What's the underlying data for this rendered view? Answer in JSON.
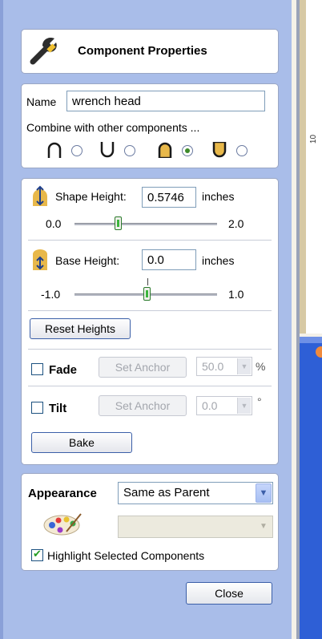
{
  "header": {
    "title": "Component Properties",
    "icon": "wrench-icon"
  },
  "name_section": {
    "name_label": "Name",
    "name_value": "wrench head",
    "combine_label": "Combine with other components ...",
    "combine_modes": [
      {
        "icon": "add-mode-icon",
        "selected": false
      },
      {
        "icon": "subtract-mode-icon",
        "selected": false
      },
      {
        "icon": "merge-high-mode-icon",
        "selected": true
      },
      {
        "icon": "merge-low-mode-icon",
        "selected": false
      }
    ]
  },
  "shape_height": {
    "label": "Shape Height:",
    "value": "0.5746",
    "unit": "inches",
    "min": "0.0",
    "max": "2.0",
    "slider_value": 0.5746
  },
  "base_height": {
    "label": "Base Height:",
    "value": "0.0",
    "unit": "inches",
    "min": "-1.0",
    "max": "1.0",
    "slider_value": 0.0
  },
  "reset_button": "Reset Heights",
  "fade": {
    "label": "Fade",
    "checked": false,
    "anchor_button": "Set Anchor",
    "value": "50.0",
    "unit": "%"
  },
  "tilt": {
    "label": "Tilt",
    "checked": false,
    "anchor_button": "Set Anchor",
    "value": "0.0",
    "unit": "°"
  },
  "bake_button": "Bake",
  "appearance": {
    "label": "Appearance",
    "selected": "Same as Parent",
    "palette_icon": "color-palette-icon",
    "color_value": ""
  },
  "highlight": {
    "label": "Highlight Selected Components",
    "checked": true
  },
  "close_button": "Close",
  "ruler_text": "10",
  "colors": {
    "panel": "#a9bde9",
    "accent_green": "#3bb53b",
    "button_border": "#3b5fa8"
  }
}
